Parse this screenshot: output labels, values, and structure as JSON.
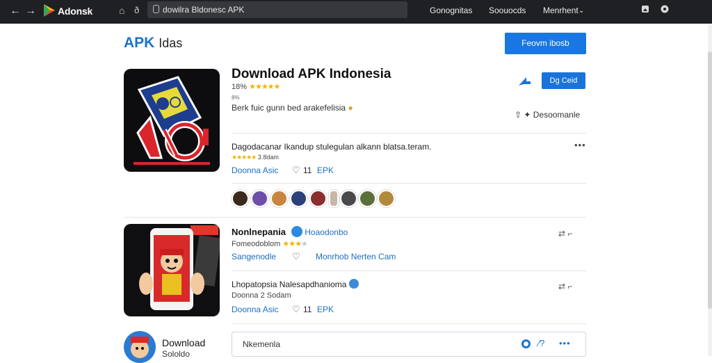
{
  "browser": {
    "brand": "Adonsk",
    "url": "dowilra Bldonesc APK",
    "links": [
      "Gonognitas",
      "Soouocds",
      "Menrhent"
    ]
  },
  "page": {
    "title": "APK",
    "title_sub": "Idas",
    "primary_button": "Feovm ibosb"
  },
  "featured": {
    "title": "Download APK Indonesia",
    "rating_text": "18%",
    "rating": 4.5,
    "small_meta": "8%",
    "description": "Berk fuic gunn bed arakefelisia",
    "install_label": "Dg Ceid",
    "recommend_label": "Desoomanle",
    "row_title": "Dagodacanar Ikandup stulegulan alkann blatsa.teram.",
    "row_rating_text": "3.8dam",
    "row_link": "Doonna Asic",
    "row_count": "11",
    "row_tag": "EPK"
  },
  "card2": {
    "title": "Nonlnepania",
    "verified_label": "Hoaodonbo",
    "meta": "Fomeodoblom",
    "rating": 3,
    "link": "Sangenodle",
    "link2": "Monrhob Nerten Cam",
    "row_title": "Lhopatopsia Nalesapdhanioma",
    "row_meta": "Doonna 2 Sodam",
    "row_link": "Doonna Asic",
    "row_count": "11",
    "row_tag": "EPK"
  },
  "card3": {
    "title": "Download",
    "subtitle": "Sololdo"
  },
  "search": {
    "placeholder": "Nkemenla"
  },
  "colors": {
    "accent": "#1877e0",
    "topbar": "#1f2023",
    "star": "#f0b400"
  }
}
